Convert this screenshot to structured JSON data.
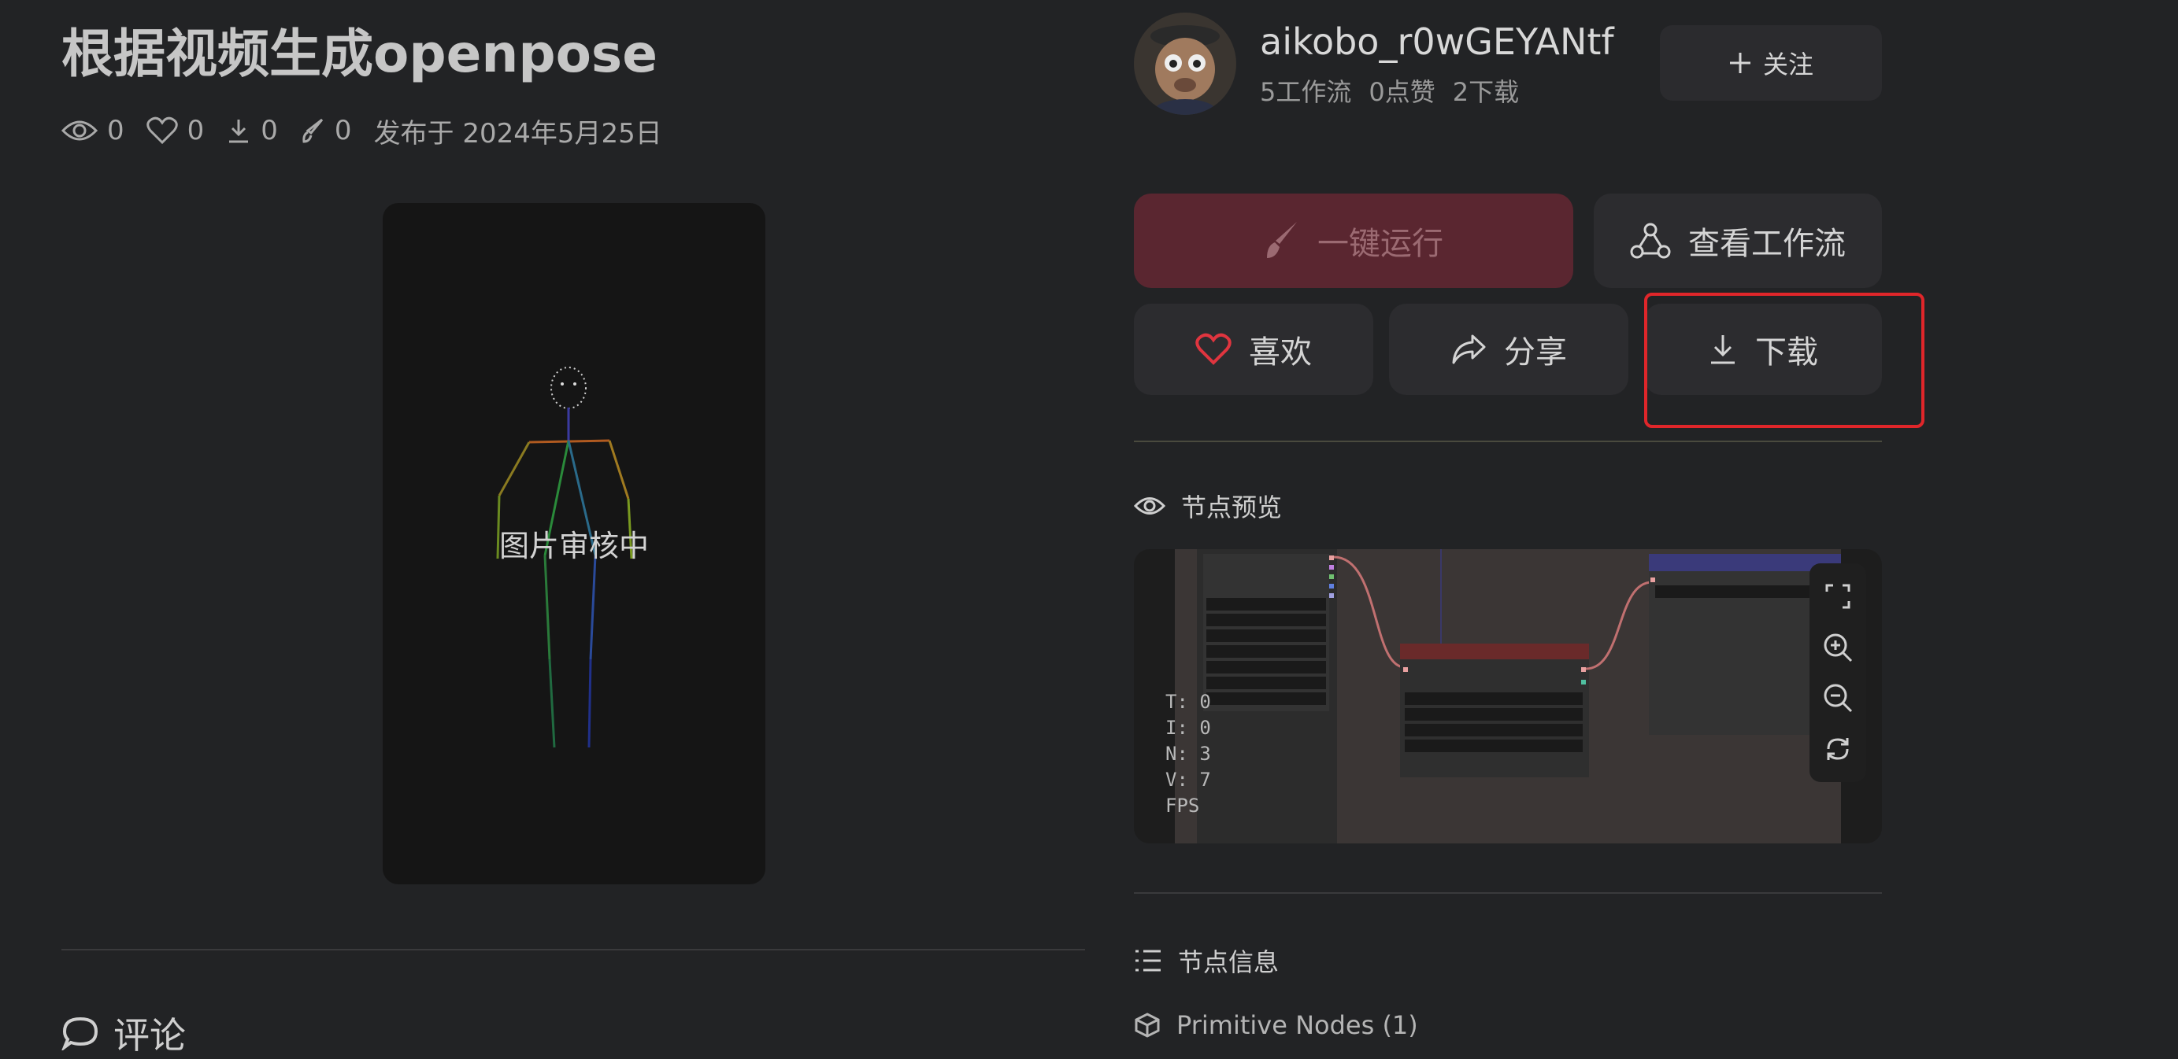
{
  "workflow": {
    "title": "根据视频生成openpose",
    "views": "0",
    "likes": "0",
    "downloads": "0",
    "runs": "0",
    "published": "发布于 2024年5月25日",
    "image_status": "图片审核中"
  },
  "author": {
    "name": "aikobo_r0wGEYANtf",
    "workflows": "5工作流",
    "likes": "0点赞",
    "downloads": "2下载",
    "follow_label": "关注"
  },
  "actions": {
    "run_label": "一键运行",
    "view_label": "查看工作流",
    "like_label": "喜欢",
    "share_label": "分享",
    "download_label": "下载"
  },
  "node_preview": {
    "title": "节点预览",
    "stats": [
      "T: 0",
      "I: 0",
      "N: 3",
      "V: 7",
      "FPS"
    ]
  },
  "node_info": {
    "title": "节点信息",
    "primitive_nodes": "Primitive Nodes (1)"
  },
  "comments": {
    "title": "评论"
  },
  "colors": {
    "background": "#222325",
    "run_button": "#5a2630",
    "like_heart": "#e0353f",
    "highlight": "#e0262a"
  }
}
